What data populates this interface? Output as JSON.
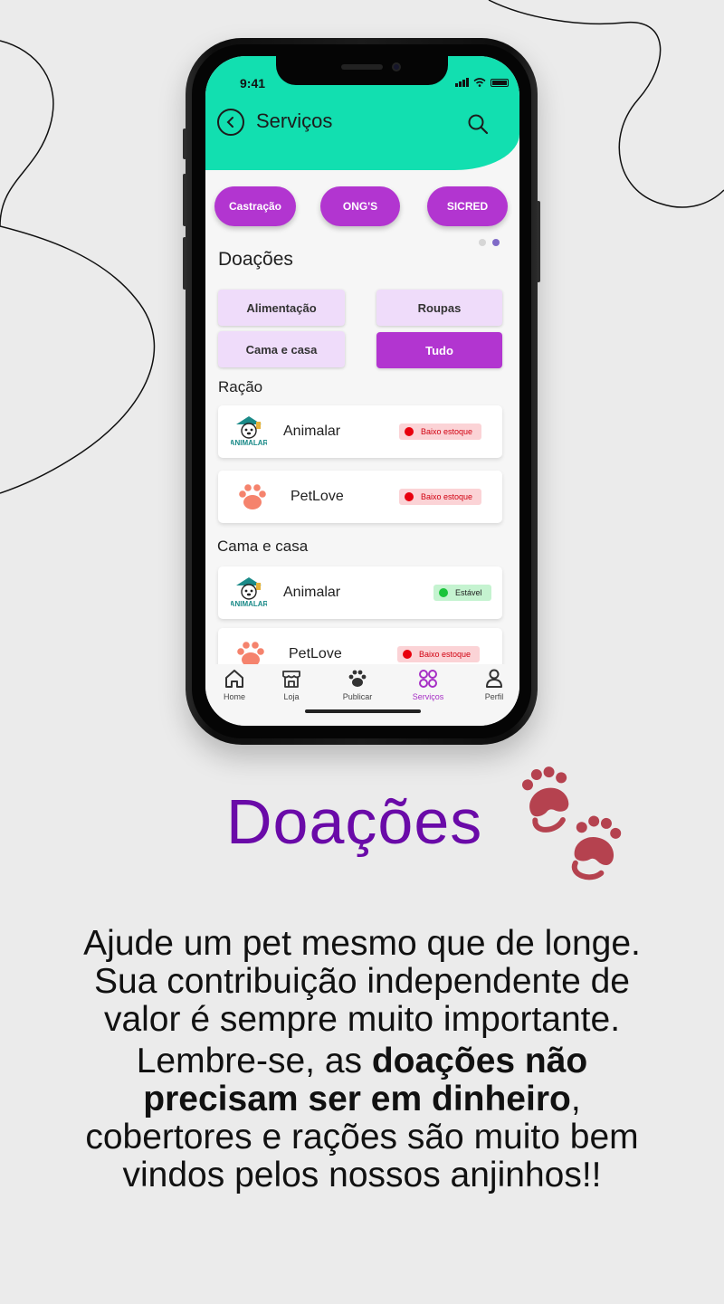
{
  "status_bar": {
    "time": "9:41"
  },
  "header": {
    "title": "Serviços"
  },
  "chips": [
    "Castração",
    "ONG'S",
    "SICRED"
  ],
  "section": {
    "title": "Doações"
  },
  "filters": [
    {
      "label": "Alimentação",
      "active": false
    },
    {
      "label": "Roupas",
      "active": false
    },
    {
      "label": "Cama e casa",
      "active": false
    },
    {
      "label": "Tudo",
      "active": true
    }
  ],
  "groups": [
    {
      "title": "Ração",
      "items": [
        {
          "name": "Animalar",
          "logo": "animalar-logo",
          "status": "Baixo estoque",
          "status_kind": "low"
        },
        {
          "name": "PetLove",
          "logo": "paw-logo",
          "status": "Baixo estoque",
          "status_kind": "low"
        }
      ]
    },
    {
      "title": "Cama e casa",
      "items": [
        {
          "name": "Animalar",
          "logo": "animalar-logo",
          "status": "Estável",
          "status_kind": "stable"
        },
        {
          "name": "PetLove",
          "logo": "paw-logo",
          "status": "Baixo estoque",
          "status_kind": "low"
        }
      ]
    }
  ],
  "logo_text": "ANIMALAR",
  "tabbar": [
    {
      "label": "Home",
      "icon": "home-icon"
    },
    {
      "label": "Loja",
      "icon": "store-icon"
    },
    {
      "label": "Publicar",
      "icon": "paw-icon"
    },
    {
      "label": "Serviços",
      "icon": "grid-icon",
      "active": true
    },
    {
      "label": "Perfil",
      "icon": "user-icon"
    }
  ],
  "promo": {
    "title": "Doações",
    "paragraph1": [
      "Ajude um pet mesmo que de longe.",
      "Sua contribuição independente de",
      "valor é sempre muito importante."
    ],
    "p2_line1_pre": "Lembre-se, as ",
    "p2_line1_bold": "doações não",
    "p2_line2_bold": "precisam ser em dinheiro",
    "p2_line2_post": ",",
    "p2_line3": "cobertores e rações são muito bem",
    "p2_line4": "vindos pelos nossos anjinhos!!"
  },
  "colors": {
    "header_green": "#12dfb0",
    "accent_purple": "#b235d0",
    "title_purple": "#6a0aa8",
    "paw_red": "#b5424f",
    "status_low": "#e8000d",
    "status_stable": "#1bc43b"
  }
}
